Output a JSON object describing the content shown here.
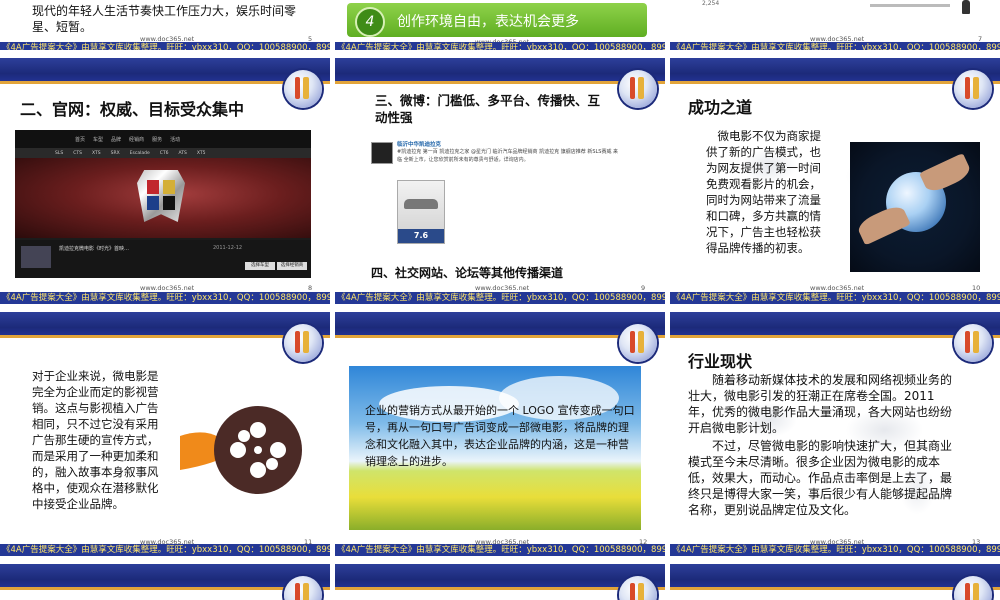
{
  "footer": {
    "text": "《4A广告提案大全》由慧享文库收集整理。旺旺：ybxx310，QQ：100588900，89988368",
    "url": "www.doc365.net"
  },
  "slides": {
    "s5": {
      "text": "现代的年轻人生活节奏快工作压力大，娱乐时间零星、短暂。",
      "page": "5"
    },
    "s6": {
      "num": "4",
      "text": "创作环境自由，表达机会更多",
      "page": "6"
    },
    "s7": {
      "page": "7",
      "small": "2,254"
    },
    "s8": {
      "title": "二、官网：权威、目标受众集中",
      "page": "8",
      "nav": [
        "首页",
        "车型",
        "品牌",
        "经销商",
        "服务",
        "活动"
      ],
      "models": [
        "SLS",
        "CTS",
        "XTS",
        "SRX",
        "Escalade",
        "CT6",
        "ATS",
        "XT5"
      ],
      "news_title": "凯迪拉克微电影《时光》首映…",
      "date": "2011-12-12",
      "btn1": "选择车型",
      "btn2": "选择经销商"
    },
    "s9": {
      "heading": "三、微博：门槛低、多平台、传播快、互动性强",
      "sub": "四、社交网站、论坛等其他传播渠道",
      "weibo_name": "临沂中华凯迪拉克",
      "weibo_text": "#凯迪拉克 第一百 凯迪拉克之家 @星光门 临沂汽车品牌经销商 凯迪拉克 旗舰店推荐 新SLS赛威 来临 全新上市，让您欣赏前所未有的尊贵与舒适，详询店内。",
      "car_price": "7.6",
      "page": "9"
    },
    "s10": {
      "title": "成功之道",
      "text": "微电影不仅为商家提供了新的广告模式，也为网友提供了第一时间免费观看影片的机会，同时为网站带来了流量和口碑，多方共赢的情况下，广告主也轻松获得品牌传播的初衷。",
      "page": "10"
    },
    "s11": {
      "text": "对于企业来说，微电影是完全为企业而定的影视营销。这点与影视植入广告相同，只不过它没有采用广告那生硬的宣传方式，而是采用了一种更加柔和的，融入故事本身叙事风格中，使观众在潜移默化中接受企业品牌。",
      "page": "11"
    },
    "s12": {
      "text": "企业的营销方式从最开始的一个 LOGO 宣传变成一句口号，再从一句口号广告词变成一部微电影，将品牌的理念和文化融入其中，表达企业品牌的内涵，这是一种营销理念上的进步。",
      "page": "12"
    },
    "s13": {
      "title": "行业现状",
      "p1": "随着移动新媒体技术的发展和网络视频业务的壮大，微电影引发的狂潮正在席卷全国。2011 年，优秀的微电影作品大量涌现，各大网站也纷纷开启微电影计划。",
      "p2": "不过，尽管微电影的影响快速扩大，但其商业模式至今未尽清晰。很多企业因为微电影的成本低，效果大，而动心。作品点击率倒是上去了，最终只是博得大家一笑，事后很少有人能够提起品牌名称，更别说品牌定位及文化。",
      "page": "13"
    }
  },
  "colors": {
    "band": "#1c2a7a",
    "footer": "#243896",
    "footer_text": "#ffe66a",
    "accent_orange": "#e2a43a",
    "green_banner": "#6bb82a"
  }
}
